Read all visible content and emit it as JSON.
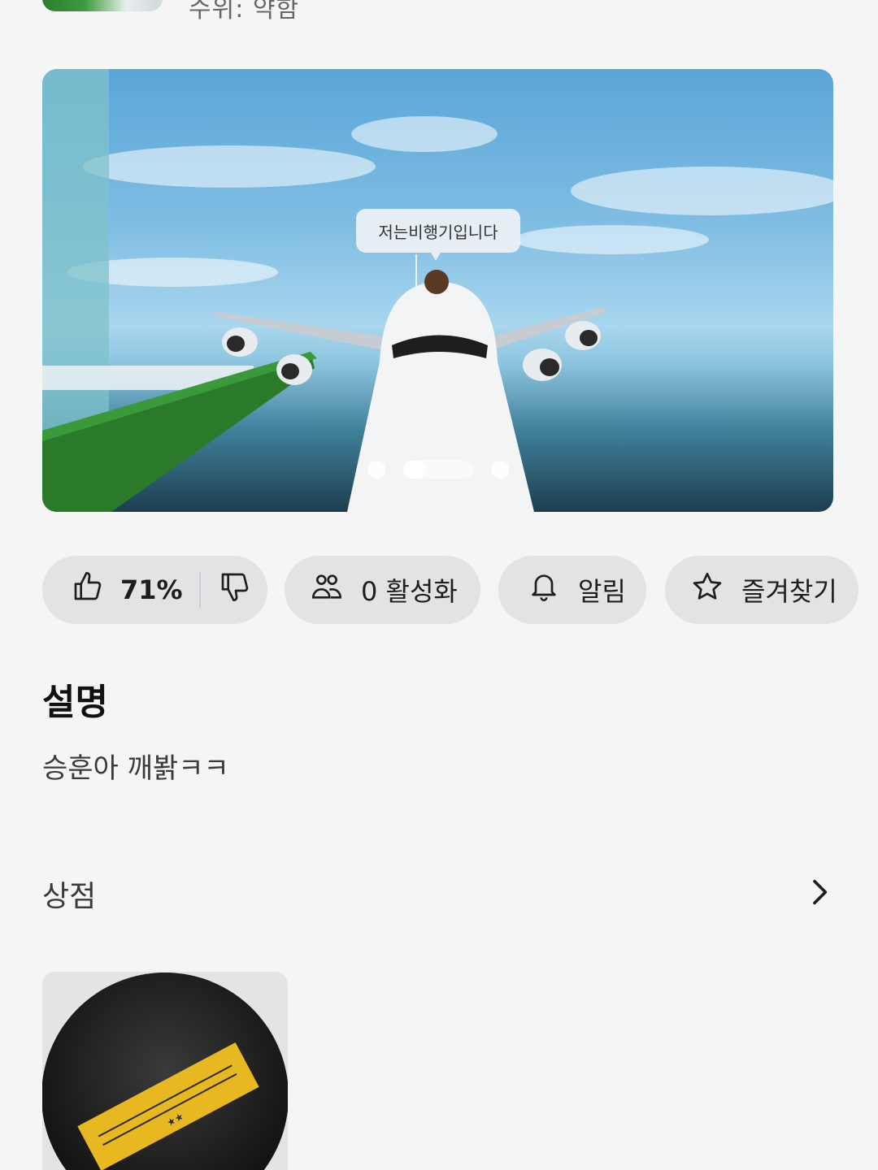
{
  "header": {
    "meta_text": "수위: 약함"
  },
  "hero": {
    "speech_bubble": "저는비행기입니다",
    "carousel_slides": 3,
    "active_slide": 2
  },
  "actions": {
    "like_percent": "71%",
    "active_label": "0 활성화",
    "notify_label": "알림",
    "favorite_label": "즐겨찾기"
  },
  "description": {
    "title": "설명",
    "body": "승훈아 깨봙ㅋㅋ"
  },
  "shop": {
    "title": "상점"
  },
  "colors": {
    "background": "#f5f5f6",
    "pill": "#e3e3e6",
    "item_gold": "#e8b820"
  }
}
